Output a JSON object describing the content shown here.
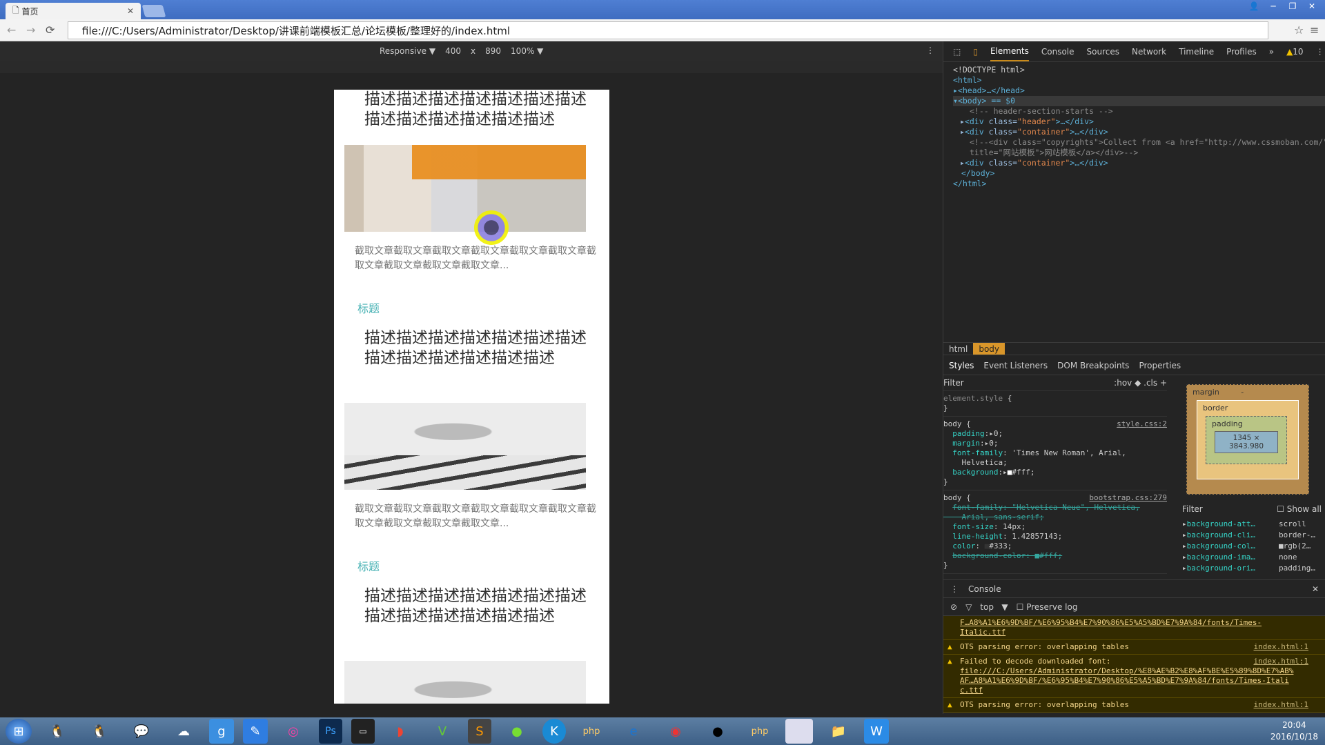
{
  "browser": {
    "tab_title": "首页",
    "url": "file:///C:/Users/Administrator/Desktop/讲课前端模板汇总/论坛模板/整理好的/index.html"
  },
  "device_toolbar": {
    "mode": "Responsive",
    "width": "400",
    "x": "x",
    "height": "890",
    "zoom": "100%"
  },
  "page": {
    "articles": [
      {
        "desc": "描述描述描述描述描述描述描述描述描述描述描述描述描述",
        "summary": "截取文章截取文章截取文章截取文章截取文章截取文章截取文章截取文章截取文章截取文章..."
      },
      {
        "title": "标题",
        "desc": "描述描述描述描述描述描述描述描述描述描述描述描述描述",
        "summary": "截取文章截取文章截取文章截取文章截取文章截取文章截取文章截取文章截取文章截取文章..."
      },
      {
        "title": "标题",
        "desc": "描述描述描述描述描述描述描述描述描述描述描述描述描述"
      }
    ]
  },
  "devtools": {
    "tabs": [
      "Elements",
      "Console",
      "Sources",
      "Network",
      "Timeline",
      "Profiles"
    ],
    "more": "»",
    "warnings": "10",
    "tree": [
      "<!DOCTYPE html>",
      "<html>",
      "<head>…</head>",
      "<body> == $0",
      "<!-- header-section-starts -->",
      "header",
      "container",
      "<!--<div class=\"copyrights\">Collect from <a href=\"http://www.cssmoban.com/\"",
      "title=\"网站模板\">网站模板</a></div>-->",
      "container",
      "</body>",
      "</html>"
    ],
    "breadcrumb": [
      "html",
      "body"
    ],
    "style_tabs": [
      "Styles",
      "Event Listeners",
      "DOM Breakpoints",
      "Properties"
    ],
    "filter": "Filter",
    "hov": ":hov",
    "cls": ".cls",
    "box_model": {
      "margin": "margin",
      "border": "border",
      "padding": "padding",
      "dash": "-",
      "content": "1345 × 3843.980"
    },
    "computed": {
      "filter": "Filter",
      "show_all": "Show all",
      "props": [
        [
          "background-att…",
          "scroll"
        ],
        [
          "background-cli…",
          "border-…"
        ],
        [
          "background-col…",
          "rgb(2…"
        ],
        [
          "background-ima…",
          "none"
        ],
        [
          "background-ori…",
          "padding…"
        ]
      ]
    },
    "console": {
      "title": "Console",
      "context": "top",
      "preserve": "Preserve log",
      "msgs": [
        {
          "text": "F…A8%A1%E6%9D%BF/%E6%95%B4%E7%90%86%E5%A5%BD%E7%9A%84/fonts/Times-Italic.ttf"
        },
        {
          "text": "OTS parsing error: overlapping tables",
          "src": "index.html:1"
        },
        {
          "text": "Failed to decode downloaded font:",
          "link": "file:///C:/Users/Administrator/Desktop/%E8%AE%B2%E8%AF%BE%E5%89%8D%E7%AB%AF…A8%A1%E6%9D%BF/%E6%95%B4%E7%90%86%E5%A5%BD%E7%9A%84/fonts/Times-Italic.ttf",
          "src": "index.html:1"
        },
        {
          "text": "OTS parsing error: overlapping tables",
          "src": "index.html:1"
        }
      ]
    }
  },
  "taskbar": {
    "time": "20:04",
    "date": "2016/10/18"
  }
}
